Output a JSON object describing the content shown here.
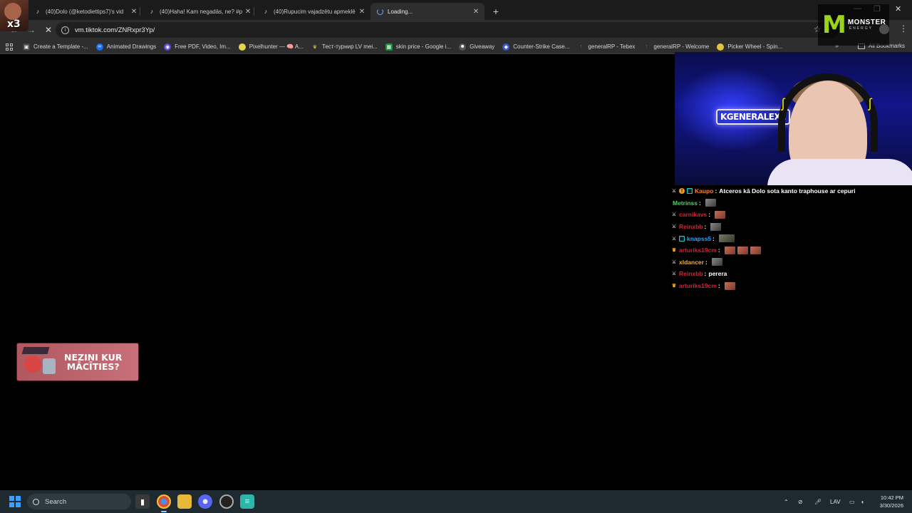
{
  "browser": {
    "tabs": [
      {
        "title": "(40)Dolo (@ketodiettips7)'s vid",
        "icon": "tiktok-icon",
        "active": false
      },
      {
        "title": "(40)Haha! Kam negadās, ne? #p",
        "icon": "tiktok-icon",
        "active": false
      },
      {
        "title": "(40)Rupucim vajadzētu apmeklē",
        "icon": "tiktok-icon",
        "active": false
      },
      {
        "title": "Loading...",
        "icon": "loading-spinner-icon",
        "active": true
      }
    ],
    "new_tab_label": "+",
    "url": "vm.tiktok.com/ZNRxpr3Yp/",
    "bookmarks": [
      {
        "label": "Create a Template -...",
        "icon": "template-icon",
        "color": "#4a4a4a"
      },
      {
        "label": "Animated Drawings",
        "icon": "meta-icon",
        "color": "#1b6ef3"
      },
      {
        "label": "Free PDF, Video, Im...",
        "icon": "globe-icon",
        "color": "#5b4ad6"
      },
      {
        "label": "Pixelhunter — 🧠 A...",
        "icon": "pixelhunter-icon",
        "color": "#e4d64a"
      },
      {
        "label": "Тест-турнир LV mei...",
        "icon": "crown-icon",
        "color": "#3b3b3b"
      },
      {
        "label": "skin price - Google i...",
        "icon": "sheets-icon",
        "color": "#1e8e3e"
      },
      {
        "label": "Giveaway",
        "icon": "discord-icon",
        "color": "#555"
      },
      {
        "label": "Counter-Strike Case...",
        "icon": "case-icon",
        "color": "#3a5bcf"
      },
      {
        "label": "generalRP - Tebex",
        "icon": "tebex-icon",
        "color": "#2aa36b"
      },
      {
        "label": "generalRP - Welcome",
        "icon": "tebex-icon",
        "color": "#2aa36b"
      },
      {
        "label": "Picker Wheel - Spin...",
        "icon": "wheel-icon",
        "color": "#e4c43a"
      }
    ],
    "all_bookmarks_label": "All Bookmarks"
  },
  "overlay": {
    "multiplier": "x3",
    "webcam_sign": "KGENERALEXE",
    "sponsor_brand": "MONSTER",
    "sponsor_sub": "ENERGY",
    "ad_text_line1": "NEZINI KUR",
    "ad_text_line2": "MĀCĪTIES?"
  },
  "chat": {
    "messages": [
      {
        "user": "Kaupo",
        "color": "#ff7f27",
        "badges": [
          "!",
          "▦"
        ],
        "text": "Atceros kā Dolo sota kanto traphouse ar cepuri",
        "emotes": 0
      },
      {
        "user": "Metrinss",
        "color": "#4fd16b",
        "badges": [],
        "text": "",
        "emotes": 1
      },
      {
        "user": "carnikavs",
        "color": "#c9283b",
        "badges": [
          "⚔"
        ],
        "text": "",
        "emotes": 1
      },
      {
        "user": "Reinxbb",
        "color": "#c9283b",
        "badges": [
          "⚔"
        ],
        "text": "",
        "emotes": 1
      },
      {
        "user": "knapss5",
        "color": "#2ea1ff",
        "badges": [
          "⚔",
          "▦"
        ],
        "text": "",
        "emotes": 1,
        "wide": true
      },
      {
        "user": "arturiks19cm",
        "color": "#c9283b",
        "badges": [
          "♛"
        ],
        "text": "",
        "emotes": 3
      },
      {
        "user": "xldancer",
        "color": "#e9b23a",
        "badges": [
          "⚔"
        ],
        "text": "",
        "emotes": 1,
        "gray": true
      },
      {
        "user": "Reinxbb",
        "color": "#c9283b",
        "badges": [
          "⚔"
        ],
        "text": "perera",
        "emotes": 0
      },
      {
        "user": "arturiks19cm",
        "color": "#c9283b",
        "badges": [
          "♛"
        ],
        "text": "",
        "emotes": 1
      }
    ],
    "separator": ":"
  },
  "taskbar": {
    "search_placeholder": "Search",
    "apps": [
      "file-explorer-icon",
      "chrome-icon",
      "folder-icon",
      "discord-icon",
      "obs-icon",
      "notepad-icon"
    ],
    "language": "LAV",
    "time": "10:42 PM",
    "date": "3/30/2026"
  },
  "colors": {
    "accent": "#8ab4f8",
    "taskbar": "#1f2a30",
    "ad": "#c8707a"
  }
}
